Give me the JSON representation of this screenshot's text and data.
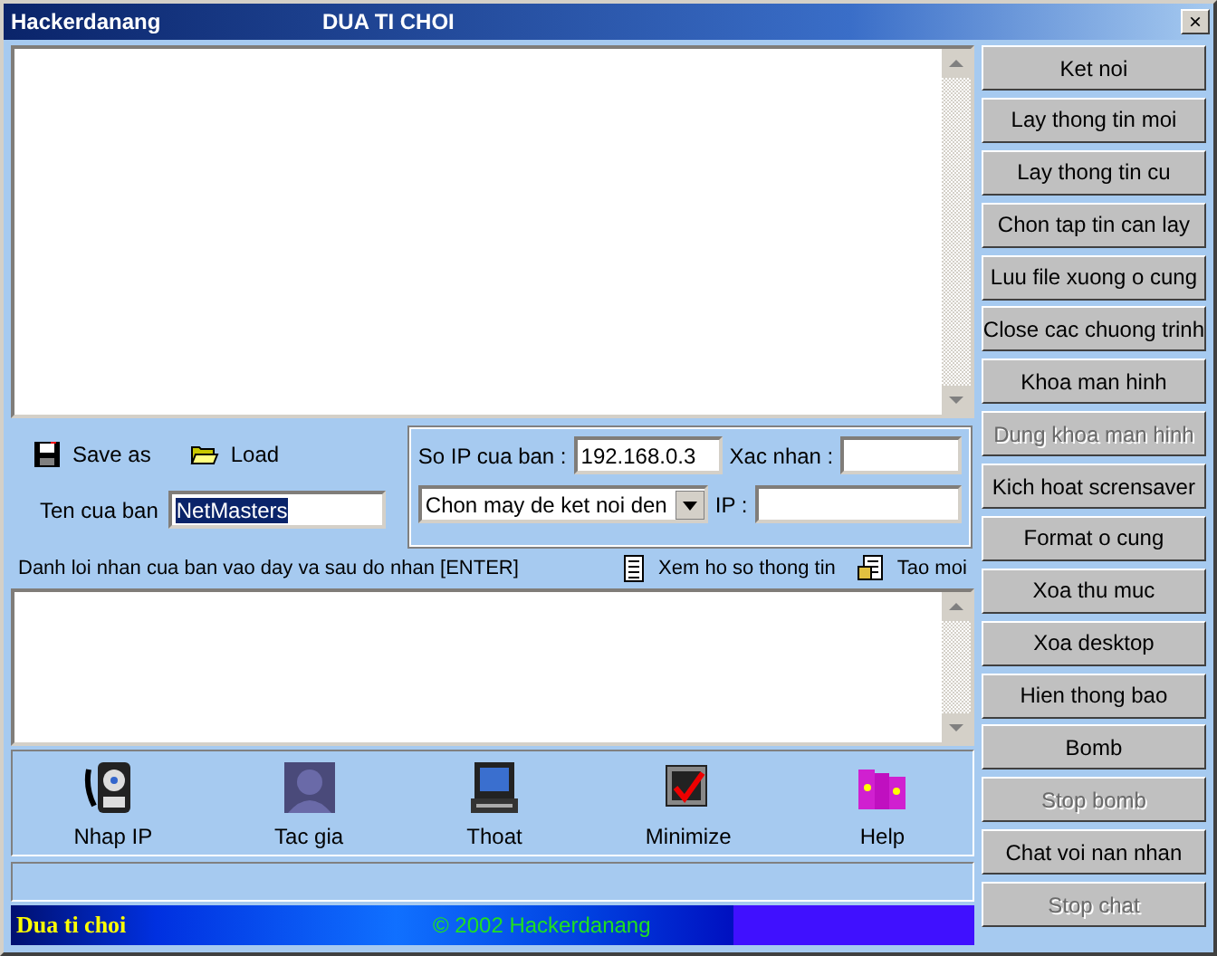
{
  "window": {
    "title": "Hackerdanang",
    "subtitle": "DUA TI CHOI",
    "close": "×"
  },
  "file_actions": [
    "Save as",
    "Load"
  ],
  "name_field": {
    "label": "Ten cua ban",
    "value": "NetMasters",
    "selected": true
  },
  "ip_group": {
    "ip_label": "So IP cua ban :",
    "ip_value": "192.168.0.3",
    "confirm_label": "Xac nhan :",
    "target_select": "Chon may de ket noi den",
    "target_ip_label": "IP :"
  },
  "message_hint": "Danh loi nhan cua ban vao day va sau do nhan [ENTER]",
  "message_links": [
    "Xem ho so thong tin",
    "Tao moi"
  ],
  "toolbar": [
    "Nhap IP",
    "Tac gia",
    "Thoat",
    "Minimize",
    "Help"
  ],
  "commands": [
    {
      "label": "Ket noi",
      "disabled": false
    },
    {
      "label": "Lay thong tin moi",
      "disabled": false
    },
    {
      "label": "Lay thong tin cu",
      "disabled": false
    },
    {
      "label": "Chon tap tin can lay",
      "disabled": false
    },
    {
      "label": "Luu file xuong o cung",
      "disabled": false
    },
    {
      "label": "Close cac chuong trinh",
      "disabled": false
    },
    {
      "label": "Khoa man hinh",
      "disabled": false
    },
    {
      "label": "Dung khoa man hinh",
      "disabled": true
    },
    {
      "label": "Kich hoat scrensaver",
      "disabled": false
    },
    {
      "label": "Format o cung",
      "disabled": false
    },
    {
      "label": "Xoa thu muc",
      "disabled": false
    },
    {
      "label": "Xoa desktop",
      "disabled": false
    },
    {
      "label": "Hien thong bao",
      "disabled": false
    },
    {
      "label": "Bomb",
      "disabled": false
    },
    {
      "label": "Stop bomb",
      "disabled": true
    },
    {
      "label": "Chat voi nan nhan",
      "disabled": false
    },
    {
      "label": "Stop chat",
      "disabled": true
    }
  ],
  "banner": {
    "title": "Dua ti choi",
    "copyright": "© 2002 Hackerdanang"
  }
}
